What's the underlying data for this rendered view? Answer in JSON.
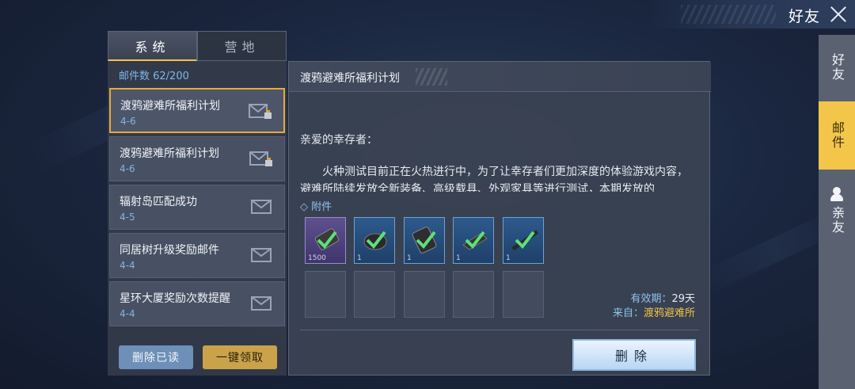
{
  "header": {
    "title": "好友"
  },
  "sidenav": {
    "items": [
      {
        "label": "好友",
        "active": false
      },
      {
        "label": "邮件",
        "active": true
      },
      {
        "label": "亲友",
        "active": false,
        "icon": "person-icon"
      }
    ]
  },
  "tabs": [
    {
      "label": "系统",
      "active": true
    },
    {
      "label": "营地",
      "active": false
    }
  ],
  "mailbox": {
    "count_label": "邮件数 62/200",
    "items": [
      {
        "title": "渡鸦避难所福利计划",
        "date": "4-6",
        "icon": "opened-envelope-icon",
        "selected": true
      },
      {
        "title": "渡鸦避难所福利计划",
        "date": "4-6",
        "icon": "opened-envelope-icon",
        "selected": false
      },
      {
        "title": "辐射岛匹配成功",
        "date": "4-5",
        "icon": "envelope-icon",
        "selected": false
      },
      {
        "title": "同居树升级奖励邮件",
        "date": "4-4",
        "icon": "envelope-icon",
        "selected": false
      },
      {
        "title": "星环大厦奖励次数提醒",
        "date": "4-4",
        "icon": "envelope-icon",
        "selected": false
      }
    ],
    "delete_read_label": "删除已读",
    "claim_all_label": "一键领取"
  },
  "mail": {
    "subject": "渡鸦避难所福利计划",
    "greeting": "亲爱的幸存者：",
    "body": "火种测试目前正在火热进行中，为了让幸存者们更加深度的体验游戏内容，避难所陆续发放全新装备、高级载具、外观家具等进行测试，本期发放的",
    "attachments_label": "◇ 附件",
    "attachments": [
      {
        "icon": "purple-item-icon",
        "qty": "1500"
      },
      {
        "icon": "armor-icon",
        "qty": "1"
      },
      {
        "icon": "vest-icon",
        "qty": "1"
      },
      {
        "icon": "boots-icon",
        "qty": "1"
      },
      {
        "icon": "rifle-icon",
        "qty": "1"
      }
    ],
    "expiry_label": "有效期：",
    "expiry_value": "29天",
    "from_label": "来自：",
    "from_value": "渡鸦避难所",
    "delete_label": "删除"
  },
  "colors": {
    "accent": "#f0c24a",
    "link_blue": "#7fb6e6",
    "panel": "#3a4252"
  }
}
